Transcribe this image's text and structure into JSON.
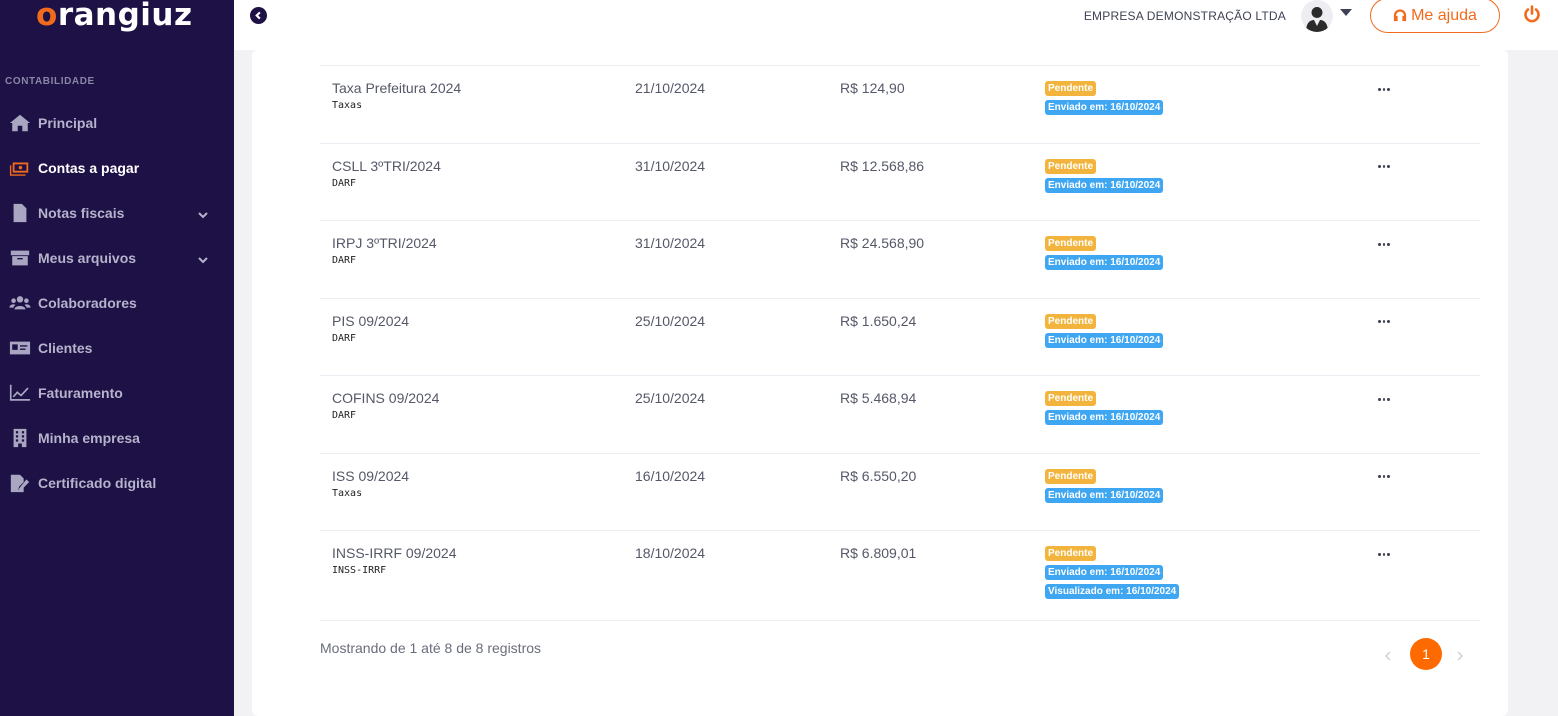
{
  "sidebar": {
    "logo": "orangiuz",
    "section_label": "CONTABILIDADE",
    "items": [
      {
        "label": "Principal",
        "icon": "home-icon"
      },
      {
        "label": "Contas a pagar",
        "icon": "money-icon",
        "active": true
      },
      {
        "label": "Notas fiscais",
        "icon": "invoice-icon",
        "has_chevron": true
      },
      {
        "label": "Meus arquivos",
        "icon": "archive-icon",
        "has_chevron": true
      },
      {
        "label": "Colaboradores",
        "icon": "users-icon"
      },
      {
        "label": "Clientes",
        "icon": "id-card-icon"
      },
      {
        "label": "Faturamento",
        "icon": "chart-line-icon"
      },
      {
        "label": "Minha empresa",
        "icon": "building-icon"
      },
      {
        "label": "Certificado digital",
        "icon": "certificate-icon"
      }
    ]
  },
  "header": {
    "company": "EMPRESA DEMONSTRAÇÃO LTDA",
    "help_label": "Me ajuda"
  },
  "table": {
    "rows": [
      {
        "name": "Taxa Prefeitura 2024",
        "type": "Taxas",
        "due": "21/10/2024",
        "value": "R$ 124,90",
        "status": "Pendente",
        "sent": "Enviado em: 16/10/2024"
      },
      {
        "name": "CSLL 3ºTRI/2024",
        "type": "DARF",
        "due": "31/10/2024",
        "value": "R$ 12.568,86",
        "status": "Pendente",
        "sent": "Enviado em: 16/10/2024"
      },
      {
        "name": "IRPJ 3ºTRI/2024",
        "type": "DARF",
        "due": "31/10/2024",
        "value": "R$ 24.568,90",
        "status": "Pendente",
        "sent": "Enviado em: 16/10/2024"
      },
      {
        "name": "PIS 09/2024",
        "type": "DARF",
        "due": "25/10/2024",
        "value": "R$ 1.650,24",
        "status": "Pendente",
        "sent": "Enviado em: 16/10/2024"
      },
      {
        "name": "COFINS 09/2024",
        "type": "DARF",
        "due": "25/10/2024",
        "value": "R$ 5.468,94",
        "status": "Pendente",
        "sent": "Enviado em: 16/10/2024"
      },
      {
        "name": "ISS 09/2024",
        "type": "Taxas",
        "due": "16/10/2024",
        "value": "R$ 6.550,20",
        "status": "Pendente",
        "sent": "Enviado em: 16/10/2024"
      },
      {
        "name": "INSS-IRRF 09/2024",
        "type": "INSS-IRRF",
        "due": "18/10/2024",
        "value": "R$ 6.809,01",
        "status": "Pendente",
        "sent": "Enviado em: 16/10/2024",
        "viewed": "Visualizado em: 16/10/2024"
      }
    ]
  },
  "footer": {
    "info": "Mostrando de 1 até 8 de 8 registros",
    "current_page": "1"
  },
  "colors": {
    "sidebar_bg": "#1d1145",
    "accent": "#f26b1d",
    "pending": "#f2b43d",
    "sent": "#3fa6f2",
    "page_active": "#ff6a00"
  }
}
